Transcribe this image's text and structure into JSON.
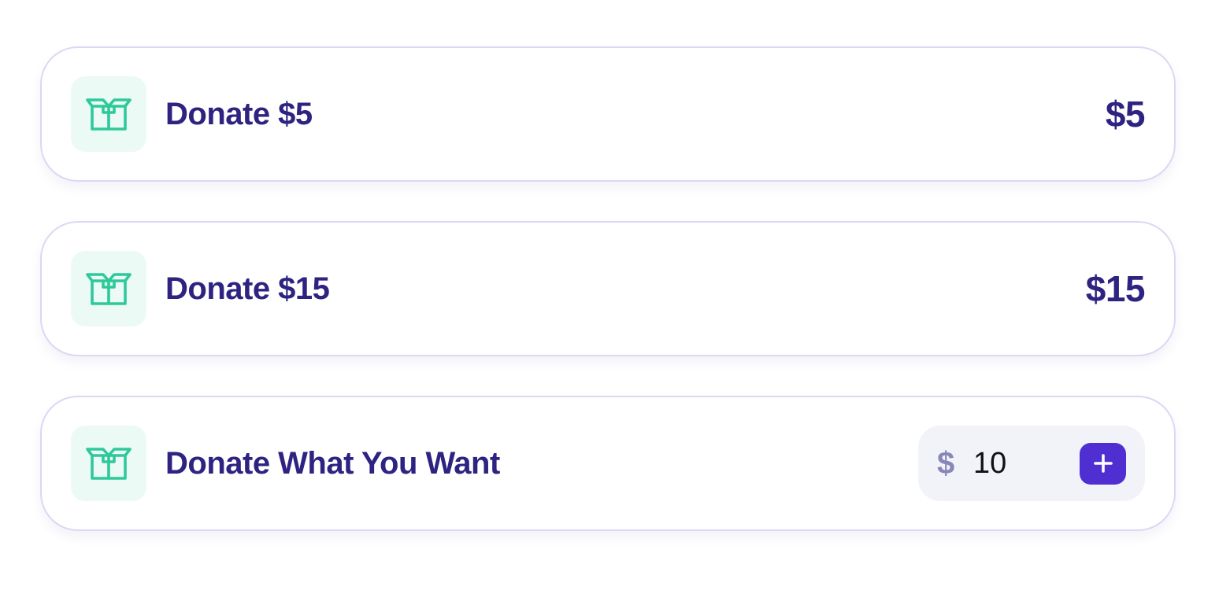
{
  "donations": [
    {
      "label": "Donate $5",
      "amount": "$5",
      "icon": "box-icon"
    },
    {
      "label": "Donate $15",
      "amount": "$15",
      "icon": "box-icon"
    }
  ],
  "custom": {
    "label": "Donate What You Want",
    "currency_symbol": "$",
    "value": "10",
    "icon": "box-icon",
    "add_icon": "plus-icon"
  },
  "colors": {
    "primary_text": "#2e2380",
    "icon_green": "#2ec99a",
    "icon_background": "#ebfaf5",
    "button_purple": "#4f2fd1",
    "card_border": "#dcd8f4"
  }
}
